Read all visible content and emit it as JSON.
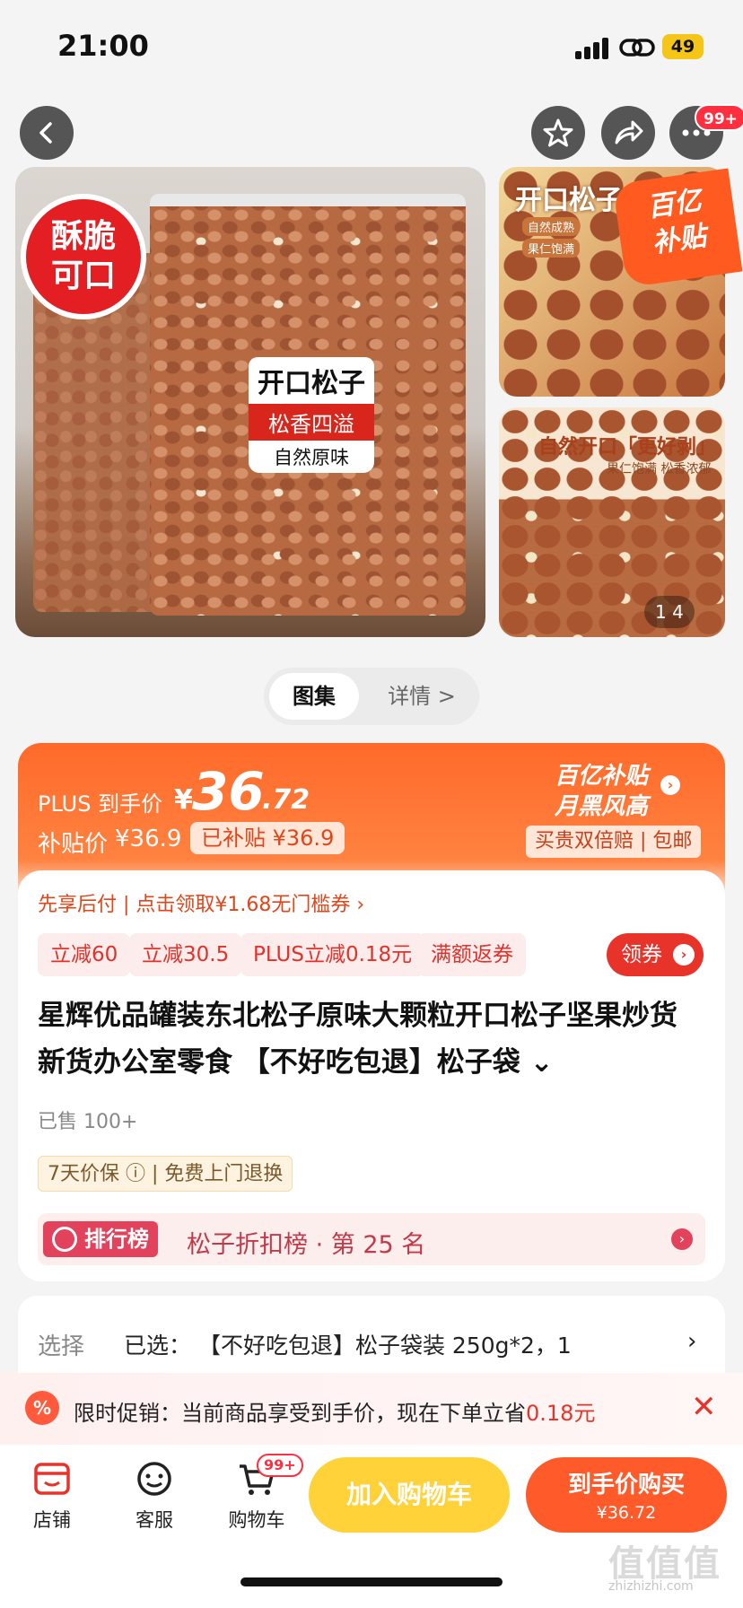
{
  "status_bar": {
    "time": "21:00",
    "battery": "49"
  },
  "nav": {
    "cart_badge": "99+"
  },
  "gallery": {
    "main_badge_line1": "酥脆",
    "main_badge_line2": "可口",
    "label_title": "开口松子",
    "label_sub": "松香四溢",
    "label_foot": "自然原味",
    "thumb1_title": "开口松子",
    "thumb1_tag1": "自然成熟",
    "thumb1_tag2": "果仁饱满",
    "subsidy_line1": "百亿",
    "subsidy_line2": "补贴",
    "thumb2_title": "自然开口「更好剥」",
    "thumb2_sub": "果仁饱满 松香浓郁",
    "counter": "1  4"
  },
  "tabs": {
    "gallery": "图集",
    "detail": "详情 >"
  },
  "price": {
    "plus_label": "PLUS 到手价",
    "yen": "¥",
    "main": "36",
    "decimal": ".72",
    "subsidy_label": "补贴价",
    "subsidy_value": "¥36.9",
    "subsidized": "已补贴 ¥36.9",
    "brand_line1": "百亿补贴",
    "brand_line2": "月黑风高",
    "guarantee": "买贵双倍赔 | 包邮"
  },
  "promo_line": "先享后付 | 点击领取¥1.68无门槛券 ›",
  "chips": [
    "立减60",
    "立减30.5",
    "PLUS立减0.18元",
    "满额返券"
  ],
  "coupon_button": "领券",
  "product_title": "星辉优品罐装东北松子原味大颗粒开口松子坚果炒货新货办公室零食 【不好吃包退】松子袋 ⌄",
  "sold": "已售 100+",
  "service": "7天价保 ⓘ | 免费上门退换",
  "ranking": {
    "tag": "排行榜",
    "text": "松子折扣榜 · 第 25 名"
  },
  "select": {
    "label": "选择",
    "value": "已选： 【不好吃包退】松子袋装 250g*2，1"
  },
  "promo_banner": {
    "prefix": "限时促销：当前商品享受到手价，现在下单立省",
    "amount": "0.18元"
  },
  "bottom_bar": {
    "shop": "店铺",
    "service": "客服",
    "cart": "购物车",
    "cart_badge": "99+",
    "add_cart": "加入购物车",
    "buy_now": "到手价购买",
    "buy_now_price": "¥36.72"
  },
  "watermark": {
    "main": "值值值",
    "sub": "zhizhizhi.com"
  },
  "colors": {
    "accent": "#ff5a2a",
    "cart_button": "#ffd23a",
    "red": "#e8332a"
  }
}
